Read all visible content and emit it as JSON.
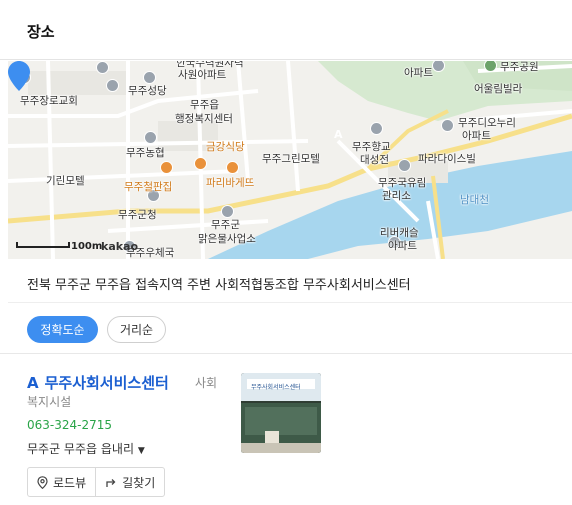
{
  "header": {
    "title": "장소"
  },
  "map": {
    "labels": [
      {
        "text": "한국수력원자력",
        "color": "dark"
      },
      {
        "text": "사원아파트",
        "color": "dark"
      },
      {
        "text": "무주성당",
        "color": "dark"
      },
      {
        "text": "무주읍",
        "color": "dark"
      },
      {
        "text": "행정복지센터",
        "color": "dark"
      },
      {
        "text": "무주장로교회",
        "color": "dark"
      },
      {
        "text": "무주농협",
        "color": "dark"
      },
      {
        "text": "금강식당",
        "color": "orange"
      },
      {
        "text": "무주그린모텔",
        "color": "dark"
      },
      {
        "text": "무주향교",
        "color": "dark"
      },
      {
        "text": "대성전",
        "color": "dark"
      },
      {
        "text": "파리바게뜨",
        "color": "orange"
      },
      {
        "text": "기린모텔",
        "color": "dark"
      },
      {
        "text": "무주철판집",
        "color": "orange"
      },
      {
        "text": "무주군청",
        "color": "dark"
      },
      {
        "text": "무주군",
        "color": "dark"
      },
      {
        "text": "맑은물사업소",
        "color": "dark"
      },
      {
        "text": "무주우체국",
        "color": "dark"
      },
      {
        "text": "파라다이스빌",
        "color": "dark"
      },
      {
        "text": "무주국유림",
        "color": "dark"
      },
      {
        "text": "관리소",
        "color": "dark"
      },
      {
        "text": "남대천",
        "color": "blue"
      },
      {
        "text": "리버캐슬",
        "color": "dark"
      },
      {
        "text": "아파트",
        "color": "dark"
      },
      {
        "text": "아파트",
        "color": "dark"
      },
      {
        "text": "무주공원",
        "color": "dark"
      },
      {
        "text": "어울림빌라",
        "color": "dark"
      },
      {
        "text": "무주디오누리",
        "color": "dark"
      },
      {
        "text": "아파트",
        "color": "dark"
      }
    ],
    "pin_letter": "A",
    "scale_label": "100m",
    "brand": "kakao"
  },
  "address": {
    "prefix": "전북 무주군 무주읍 접속지역 주변",
    "highlight": "사회적협동조합 무주사회서비스센터"
  },
  "sort": {
    "accuracy": "정확도순",
    "distance": "거리순"
  },
  "result": {
    "letter": "A",
    "name": "무주사회서비스센터",
    "category_part1": "사회",
    "category_part2": "복지시설",
    "phone": "063-324-2715",
    "address": "무주군 무주읍 읍내리",
    "roadview": "로드뷰",
    "directions": "길찾기",
    "thumb_sign": "무주사회서비스센터"
  },
  "colors": {
    "accent": "#3d8ef0",
    "title_blue": "#1b5fd1",
    "phone_green": "#2aa448",
    "river": "#a7d6ee",
    "park": "#d6e9d0"
  }
}
